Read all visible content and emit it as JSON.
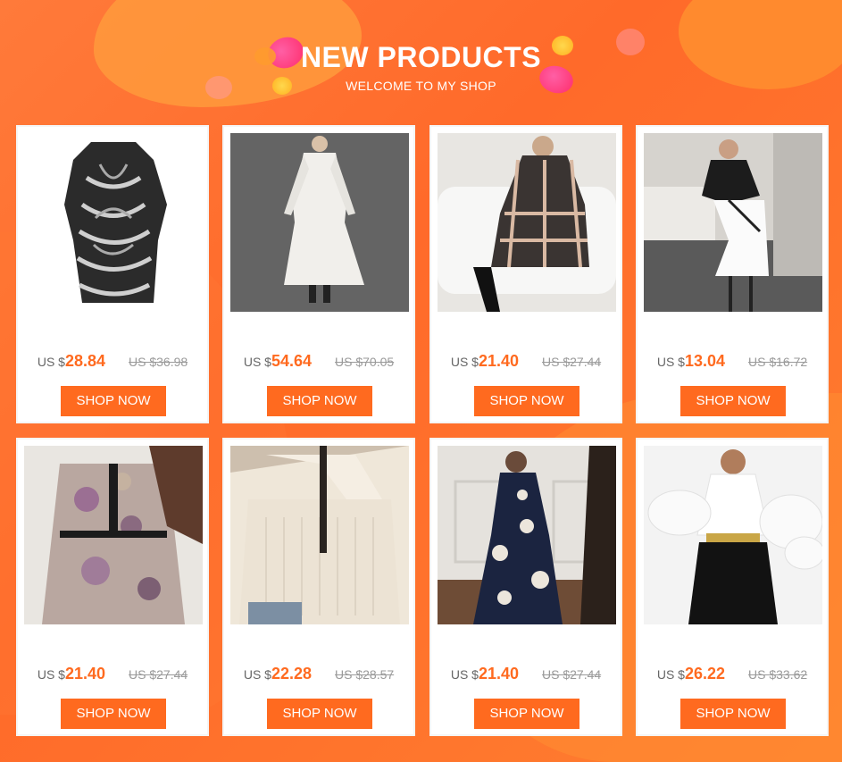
{
  "header": {
    "title": "NEW PRODUCTS",
    "subtitle": "WELCOME TO MY SHOP"
  },
  "colors": {
    "accent": "#ff6a1f",
    "background": "#ff7a3a",
    "card": "#ffffff"
  },
  "products": [
    {
      "currency": "US $",
      "price": "28.84",
      "old_price": "US $36.98",
      "button": "SHOP NOW",
      "image": "black-white-swirl-print-shirt-dress"
    },
    {
      "currency": "US $",
      "price": "54.64",
      "old_price": "US $70.05",
      "button": "SHOP NOW",
      "image": "white-lace-ruffle-maxi-dress"
    },
    {
      "currency": "US $",
      "price": "21.40",
      "old_price": "US $27.44",
      "button": "SHOP NOW",
      "image": "plaid-long-sleeve-dress"
    },
    {
      "currency": "US $",
      "price": "13.04",
      "old_price": "US $16.72",
      "button": "SHOP NOW",
      "image": "black-top-white-ruffle-skirt"
    },
    {
      "currency": "US $",
      "price": "21.40",
      "old_price": "US $27.44",
      "button": "SHOP NOW",
      "image": "floral-ruffle-dress-black-trim"
    },
    {
      "currency": "US $",
      "price": "22.28",
      "old_price": "US $28.57",
      "button": "SHOP NOW",
      "image": "cream-knit-sweater"
    },
    {
      "currency": "US $",
      "price": "21.40",
      "old_price": "US $27.44",
      "button": "SHOP NOW",
      "image": "navy-floral-wrap-dress"
    },
    {
      "currency": "US $",
      "price": "26.22",
      "old_price": "US $33.62",
      "button": "SHOP NOW",
      "image": "white-ruffle-blouse-black-pants"
    }
  ]
}
